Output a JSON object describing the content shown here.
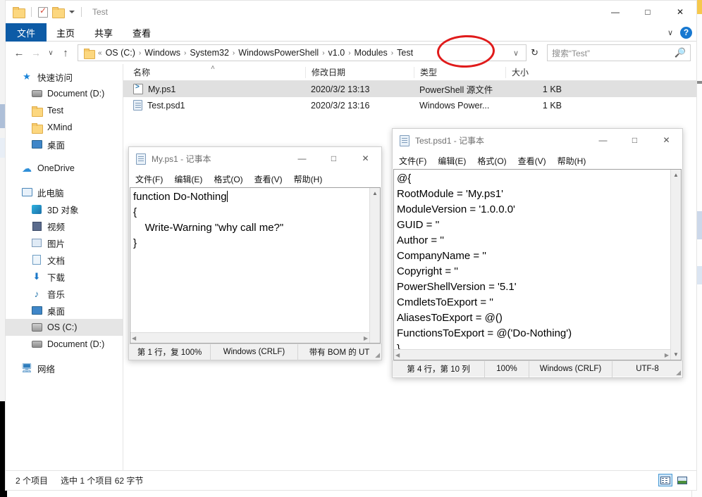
{
  "explorer": {
    "window_title": "Test",
    "quick_access_toolbar": [
      {
        "name": "folder-icon",
        "label": ""
      },
      {
        "name": "properties-icon",
        "label": ""
      },
      {
        "name": "new-folder-icon",
        "label": ""
      },
      {
        "name": "customize-caret-icon",
        "label": ""
      }
    ],
    "window_controls": {
      "minimize": "—",
      "maximize": "□",
      "close": "✕"
    },
    "ribbon_tabs": [
      {
        "label": "文件",
        "active": true
      },
      {
        "label": "主页",
        "active": false
      },
      {
        "label": "共享",
        "active": false
      },
      {
        "label": "查看",
        "active": false
      }
    ],
    "ribbon_right": {
      "expand_caret": "∨",
      "help": "?"
    },
    "navigation": {
      "back": "←",
      "forward": "→",
      "recent": "∨",
      "up": "↑",
      "overflow": "«",
      "dropdown": "∨",
      "refresh": "↻"
    },
    "breadcrumbs": [
      "OS (C:)",
      "Windows",
      "System32",
      "WindowsPowerShell",
      "v1.0",
      "Modules",
      "Test"
    ],
    "breadcrumb_separator": "›",
    "search": {
      "placeholder": "搜索“Test”",
      "value": "",
      "icon": "search-icon"
    },
    "nav_pane": [
      {
        "label": "快速访问",
        "icon": "star-icon",
        "indent": 0,
        "selected": false
      },
      {
        "label": "Document (D:)",
        "icon": "drive-icon",
        "indent": 1,
        "selected": false
      },
      {
        "label": "Test",
        "icon": "folder-icon",
        "indent": 1,
        "selected": false
      },
      {
        "label": "XMind",
        "icon": "folder-icon",
        "indent": 1,
        "selected": false
      },
      {
        "label": "桌面",
        "icon": "desktop-icon",
        "indent": 1,
        "selected": false
      },
      {
        "label": "OneDrive",
        "icon": "cloud-icon",
        "indent": 0,
        "selected": false
      },
      {
        "label": "此电脑",
        "icon": "this-pc-icon",
        "indent": 0,
        "selected": false
      },
      {
        "label": "3D 对象",
        "icon": "3d-objects-icon",
        "indent": 1,
        "selected": false
      },
      {
        "label": "视频",
        "icon": "videos-icon",
        "indent": 1,
        "selected": false
      },
      {
        "label": "图片",
        "icon": "pictures-icon",
        "indent": 1,
        "selected": false
      },
      {
        "label": "文档",
        "icon": "documents-icon",
        "indent": 1,
        "selected": false
      },
      {
        "label": "下载",
        "icon": "downloads-icon",
        "indent": 1,
        "selected": false
      },
      {
        "label": "音乐",
        "icon": "music-icon",
        "indent": 1,
        "selected": false
      },
      {
        "label": "桌面",
        "icon": "desktop-icon",
        "indent": 1,
        "selected": false
      },
      {
        "label": "OS (C:)",
        "icon": "os-drive-icon",
        "indent": 1,
        "selected": true
      },
      {
        "label": "Document (D:)",
        "icon": "drive-icon",
        "indent": 1,
        "selected": false
      },
      {
        "label": "网络",
        "icon": "network-icon",
        "indent": 0,
        "selected": false
      }
    ],
    "columns": [
      {
        "key": "name",
        "label": "名称"
      },
      {
        "key": "date",
        "label": "修改日期"
      },
      {
        "key": "type",
        "label": "类型"
      },
      {
        "key": "size",
        "label": "大小"
      }
    ],
    "sort_indicator": "˄",
    "files": [
      {
        "name": "My.ps1",
        "date": "2020/3/2 13:13",
        "type": "PowerShell 源文件",
        "size": "1 KB",
        "icon": "ps1-file-icon",
        "selected": true
      },
      {
        "name": "Test.psd1",
        "date": "2020/3/2 13:16",
        "type": "Windows Power...",
        "size": "1 KB",
        "icon": "psd1-file-icon",
        "selected": false
      }
    ],
    "status": {
      "item_count": "2 个项目",
      "selection": "选中 1 个项目  62 字节"
    },
    "view_buttons": [
      {
        "name": "details-view-button",
        "active": true
      },
      {
        "name": "large-icons-view-button",
        "active": false
      }
    ]
  },
  "annotation": {
    "shape": "ellipse",
    "color": "#e01b1b",
    "target": "Test"
  },
  "notepad_myps1": {
    "title": "My.ps1 - 记事本",
    "icon": "notepad-icon",
    "window_controls": {
      "minimize": "—",
      "maximize": "□",
      "close": "✕"
    },
    "menu": [
      "文件(F)",
      "编辑(E)",
      "格式(O)",
      "查看(V)",
      "帮助(H)"
    ],
    "content_lines": [
      "function Do-Nothing",
      "{",
      "    Write-Warning \"why call me?\"",
      "}"
    ],
    "status": [
      "第 1 行，复",
      "100%",
      "Windows (CRLF)",
      "带有 BOM 的 UT"
    ]
  },
  "notepad_testpsd1": {
    "title": "Test.psd1 - 记事本",
    "icon": "notepad-icon",
    "window_controls": {
      "minimize": "—",
      "maximize": "□",
      "close": "✕"
    },
    "menu": [
      "文件(F)",
      "编辑(E)",
      "格式(O)",
      "查看(V)",
      "帮助(H)"
    ],
    "content_lines": [
      "@{",
      "RootModule = 'My.ps1'",
      "ModuleVersion = '1.0.0.0'",
      "GUID = ''",
      "Author = ''",
      "CompanyName = ''",
      "Copyright = ''",
      "PowerShellVersion = '5.1'",
      "CmdletsToExport = ''",
      "AliasesToExport = @()",
      "FunctionsToExport = @('Do-Nothing')",
      "}"
    ],
    "status": [
      "第 4 行，第 10 列",
      "100%",
      "Windows (CRLF)",
      "UTF-8"
    ]
  }
}
